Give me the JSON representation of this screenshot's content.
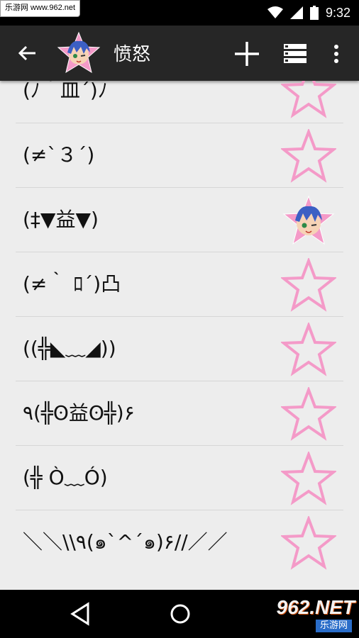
{
  "status_bar": {
    "watermark": "乐游网 www.962.net",
    "time": "9:32"
  },
  "app_bar": {
    "title": "愤怒",
    "icons": [
      "back-arrow-icon",
      "avatar-star-icon",
      "plus-icon",
      "list-icon",
      "more-vert-icon"
    ]
  },
  "list": {
    "items": [
      {
        "text": "(ﾉ｀皿´)ﾉ",
        "favorite": false
      },
      {
        "text": "(≠`３´)",
        "favorite": false
      },
      {
        "text": "(‡▼益▼)",
        "favorite": true
      },
      {
        "text": "(≠｀ ﾛ´)凸",
        "favorite": false
      },
      {
        "text": "((╬◣﹏◢))",
        "favorite": false
      },
      {
        "text": "٩(╬ʘ益ʘ╬)۶",
        "favorite": false
      },
      {
        "text": "(╬ Ò﹏Ó)",
        "favorite": false
      },
      {
        "text": "＼＼\\\\٩(๑`^´๑)۶//／／",
        "favorite": false
      }
    ]
  },
  "nav_bar": {
    "watermark_logo": "962.NET",
    "watermark_sub": "乐游网"
  },
  "colors": {
    "star_pink": "#f49ac8",
    "app_bar": "#262626",
    "background": "#ededed"
  }
}
